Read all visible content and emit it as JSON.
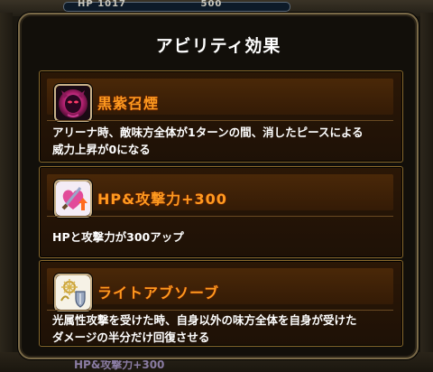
{
  "background": {
    "hp_label": "HP",
    "hp_value": "1017",
    "hp_sub": "500",
    "bottom_text": "HP&攻撃力+300"
  },
  "modal": {
    "title": "アビリティ効果"
  },
  "abilities": [
    {
      "name": "黒紫召煙",
      "icon": "purple-demon-icon",
      "description_line1": "アリーナ時、敵味方全体が1ターンの間、消したピースによる",
      "description_line2": "威力上昇が0になる"
    },
    {
      "name": "HP&攻撃力+300",
      "icon": "heart-sword-up-icon",
      "description_line1": "HPと攻撃力が300アップ",
      "description_line2": ""
    },
    {
      "name": "ライトアブソーブ",
      "icon": "light-shield-icon",
      "description_line1": "光属性攻撃を受けた時、自身以外の味方全体を自身が受けた",
      "description_line2": "ダメージの半分だけ回復させる"
    }
  ],
  "colors": {
    "ability_name": "#ff9a1f",
    "card_border": "#8a6a2c",
    "modal_border": "#7a6a48"
  }
}
